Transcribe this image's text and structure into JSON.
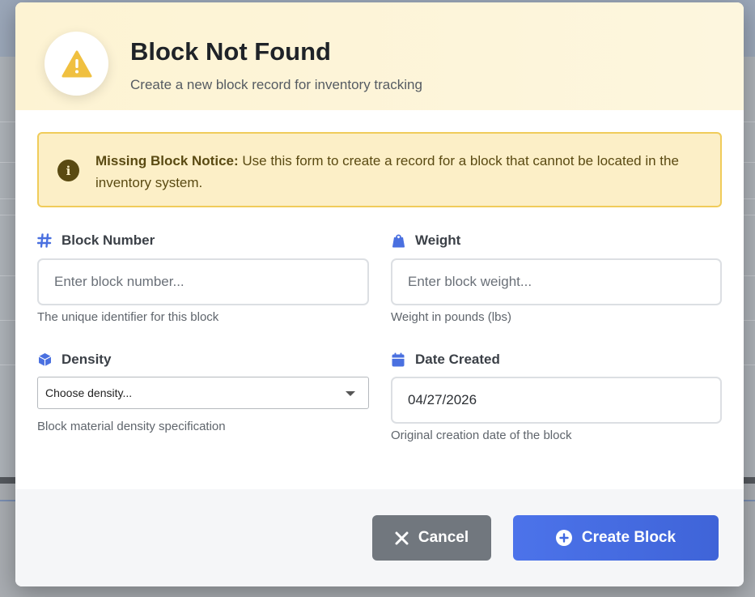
{
  "modal": {
    "title": "Block Not Found",
    "subtitle": "Create a new block record for inventory tracking"
  },
  "notice": {
    "heading": "Missing Block Notice:",
    "body": " Use this form to create a record for a block that cannot be located in the inventory system."
  },
  "fields": {
    "block_number": {
      "label": "Block Number",
      "placeholder": "Enter block number...",
      "help": "The unique identifier for this block",
      "icon": "hash-icon"
    },
    "weight": {
      "label": "Weight",
      "placeholder": "Enter block weight...",
      "help": "Weight in pounds (lbs)",
      "icon": "weight-icon"
    },
    "density": {
      "label": "Density",
      "selected": "Choose density...",
      "help": "Block material density specification",
      "icon": "cube-icon"
    },
    "date_created": {
      "label": "Date Created",
      "value": "04/27/2026",
      "help": "Original creation date of the block",
      "icon": "calendar-icon"
    }
  },
  "footer": {
    "cancel_label": "Cancel",
    "create_label": "Create Block"
  },
  "colors": {
    "accent": "#4169e1",
    "warning": "#f0c040",
    "notice_bg": "#fcefc7"
  }
}
